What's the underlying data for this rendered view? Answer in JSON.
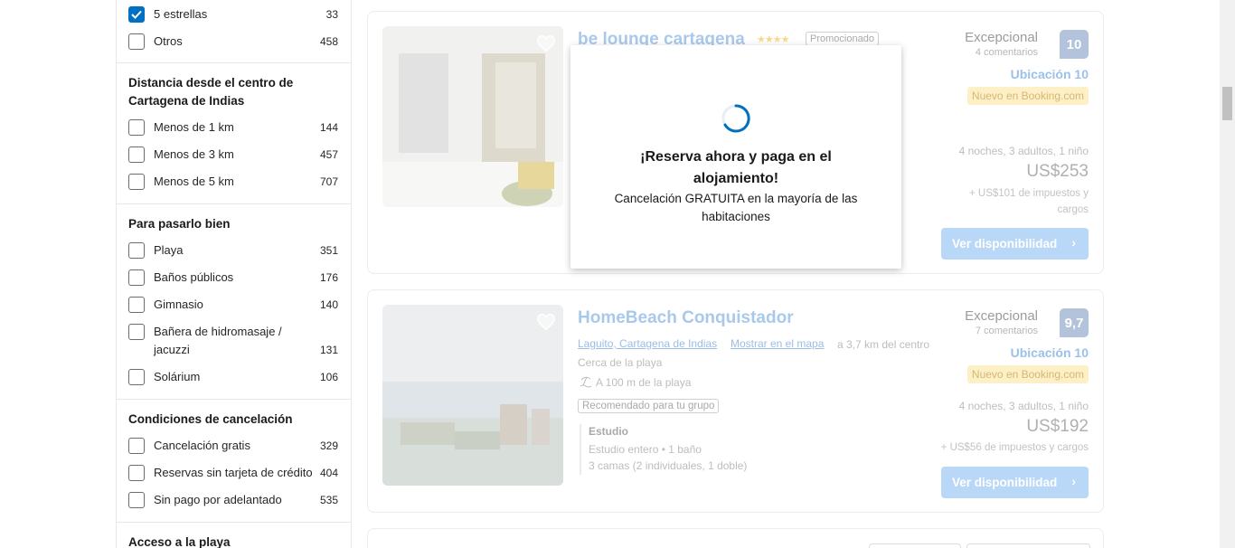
{
  "sidebar": {
    "top_options": [
      {
        "label": "5 estrellas",
        "count": "33",
        "checked": true
      },
      {
        "label": "Otros",
        "count": "458",
        "checked": false
      }
    ],
    "distance": {
      "title": "Distancia desde el centro de Cartagena de Indias",
      "options": [
        {
          "label": "Menos de 1 km",
          "count": "144"
        },
        {
          "label": "Menos de 3 km",
          "count": "457"
        },
        {
          "label": "Menos de 5 km",
          "count": "707"
        }
      ]
    },
    "fun": {
      "title": "Para pasarlo bien",
      "options": [
        {
          "label": "Playa",
          "count": "351"
        },
        {
          "label": "Baños públicos",
          "count": "176"
        },
        {
          "label": "Gimnasio",
          "count": "140"
        },
        {
          "label": "Bañera de hidromasaje / jacuzzi",
          "count": "131"
        },
        {
          "label": "Solárium",
          "count": "106"
        }
      ]
    },
    "cancellation": {
      "title": "Condiciones de cancelación",
      "options": [
        {
          "label": "Cancelación gratis",
          "count": "329"
        },
        {
          "label": "Reservas sin tarjeta de crédito",
          "count": "404"
        },
        {
          "label": "Sin pago por adelantado",
          "count": "535"
        }
      ]
    },
    "beach": {
      "title": "Acceso a la playa"
    }
  },
  "cards": [
    {
      "name": "be lounge cartagena",
      "promo": "Promocionado",
      "score_word": "Excepcional",
      "reviews": "4 comentarios",
      "score": "10",
      "location_score": "Ubicación 10",
      "new_badge": "Nuevo en Booking.com",
      "stay": "4 noches, 3 adultos, 1 niño",
      "price": "US$253",
      "taxes": "+ US$101 de impuestos y cargos",
      "cta": "Ver disponibilidad"
    },
    {
      "name": "HomeBeach Conquistador",
      "location": "Laguito, Cartagena de Indias",
      "map_link": "Mostrar en el mapa",
      "distance": "a 3,7 km del centro",
      "beach_near": "Cerca de la playa",
      "beach_dist": "A 100 m de la playa",
      "group_tag": "Recomendado para tu grupo",
      "room_type": "Estudio",
      "room_desc": "Estudio entero • 1 baño",
      "beds": "3 camas (2 individuales, 1 doble)",
      "score_word": "Excepcional",
      "reviews": "7 comentarios",
      "score": "9,7",
      "location_score": "Ubicación 10",
      "new_badge": "Nuevo en Booking.com",
      "stay": "4 noches, 3 adultos, 1 niño",
      "price": "US$192",
      "taxes": "+ US$56 de impuestos y cargos",
      "cta": "Ver disponibilidad"
    }
  ],
  "modal": {
    "title": "¡Reserva ahora y paga en el alojamiento!",
    "subtitle": "Cancelación GRATUITA en la mayoría de las habitaciones"
  },
  "colors": {
    "accent": "#0071c2",
    "brand_faded": "#a9c9ec"
  }
}
